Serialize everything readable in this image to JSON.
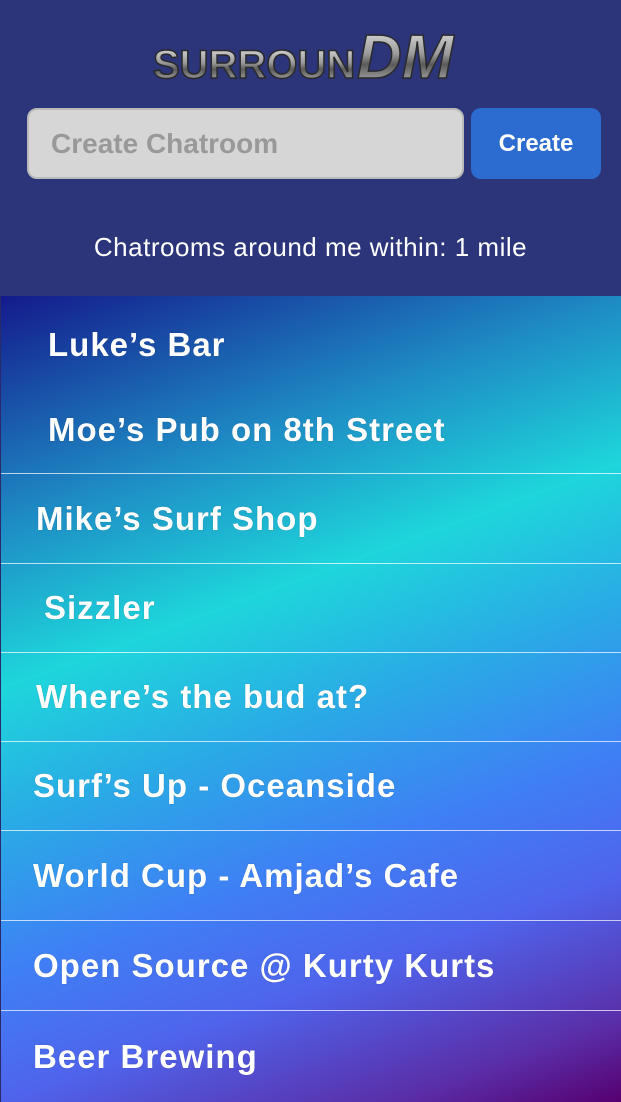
{
  "logo": {
    "part1": "SURROUN",
    "part2": "DM"
  },
  "create": {
    "placeholder": "Create Chatroom",
    "button_label": "Create"
  },
  "radius_label": "Chatrooms around me within: 1 mile",
  "chatrooms": [
    {
      "name": "Luke’s Bar"
    },
    {
      "name": "Moe’s Pub on 8th Street"
    },
    {
      "name": "Mike’s Surf Shop"
    },
    {
      "name": "Sizzler"
    },
    {
      "name": "Where’s the bud at?"
    },
    {
      "name": "Surf’s Up - Oceanside"
    },
    {
      "name": "World Cup - Amjad’s Cafe"
    },
    {
      "name": "Open Source @ Kurty Kurts"
    },
    {
      "name": "Beer Brewing"
    }
  ],
  "colors": {
    "header_bg": "#2c357a",
    "button_bg": "#2c6bd0",
    "input_bg": "#d6d6d6"
  }
}
